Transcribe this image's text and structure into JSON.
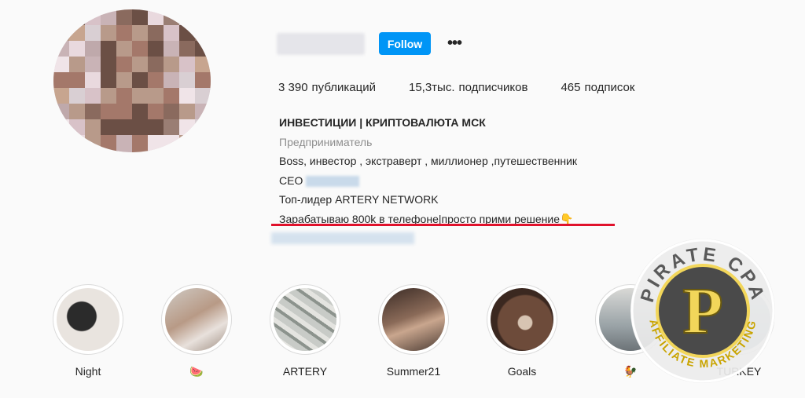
{
  "profile": {
    "follow_label": "Follow",
    "more_label": "•••",
    "stats": [
      {
        "value": "3 390",
        "label": "публикаций"
      },
      {
        "value": "15,3тыс.",
        "label": "подписчиков"
      },
      {
        "value": "465",
        "label": "подписок"
      }
    ],
    "bio": {
      "title": "ИНВЕСТИЦИИ | КРИПТОВАЛЮТА МСК",
      "category": "Предприниматель",
      "line1": "Boss, инвестор , экстраверт , миллионер ,путешественник",
      "line2": "CEO",
      "line3": "Топ-лидер ARTERY NETWORK",
      "line4": "Зарабатываю 800k в телефоне|просто прими решение👇"
    }
  },
  "highlights": [
    {
      "label": "Night",
      "icon": "photo"
    },
    {
      "label": "🍉",
      "icon": "photo"
    },
    {
      "label": "ARTERY",
      "icon": "money-photo"
    },
    {
      "label": "Summer21",
      "icon": "photo"
    },
    {
      "label": "Goals",
      "icon": "photo"
    },
    {
      "label": "🐓",
      "icon": "photo"
    },
    {
      "label": "TURKEY",
      "icon": "photo"
    }
  ],
  "watermark": {
    "top_text": "PIRATE CPA",
    "bottom_text": "AFFILIATE MARKETING",
    "letter": "P"
  },
  "colors": {
    "accent": "#0095f6",
    "underline": "#e0112b",
    "watermark_yellow": "#f2d65a"
  }
}
